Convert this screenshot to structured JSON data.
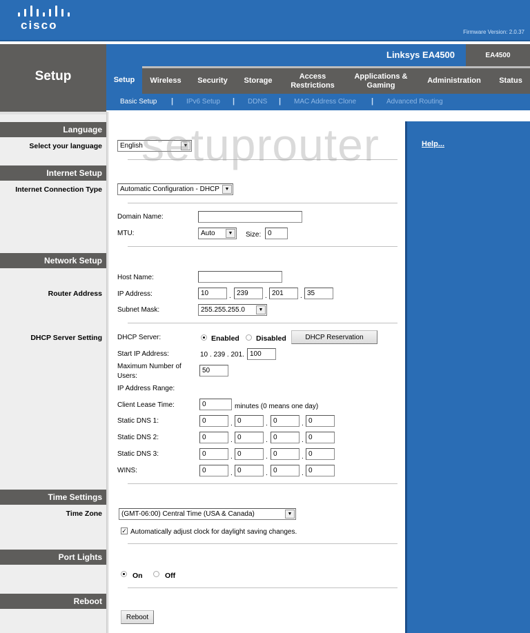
{
  "header": {
    "brand": "cisco",
    "firmware_label": "Firmware Version: 2.0.37",
    "page_title": "Setup",
    "model_name": "Linksys EA4500",
    "model_short": "EA4500"
  },
  "tabs": [
    {
      "label": "Setup",
      "active": true
    },
    {
      "label": "Wireless"
    },
    {
      "label": "Security"
    },
    {
      "label": "Storage"
    },
    {
      "label": "Access Restrictions"
    },
    {
      "label": "Applications & Gaming"
    },
    {
      "label": "Administration"
    },
    {
      "label": "Status"
    }
  ],
  "subnav": [
    {
      "label": "Basic Setup",
      "active": true
    },
    {
      "label": "IPv6 Setup"
    },
    {
      "label": "DDNS"
    },
    {
      "label": "MAC Address Clone"
    },
    {
      "label": "Advanced Routing"
    }
  ],
  "subnav_separator": "|",
  "watermark": "setuprouter",
  "help": {
    "link": "Help..."
  },
  "sections": {
    "language": {
      "heading": "Language",
      "row_label": "Select your language",
      "value": "English"
    },
    "internet": {
      "heading": "Internet Setup",
      "row_label": "Internet Connection Type",
      "connection_type": "Automatic Configuration - DHCP",
      "domain_name_label": "Domain Name:",
      "domain_name_value": "",
      "mtu_label": "MTU:",
      "mtu_value": "Auto",
      "size_label": "Size:",
      "size_value": "0"
    },
    "network": {
      "heading": "Network Setup",
      "router_address_label": "Router Address",
      "host_name_label": "Host Name:",
      "host_name_value": "",
      "ip_label": "IP Address:",
      "ip": [
        "10",
        "239",
        "201",
        "35"
      ],
      "subnet_label": "Subnet Mask:",
      "subnet_value": "255.255.255.0",
      "dhcp_setting_label": "DHCP Server Setting",
      "dhcp_server_label": "DHCP Server:",
      "enabled_label": "Enabled",
      "disabled_label": "Disabled",
      "dhcp_enabled": true,
      "dhcp_reservation_button": "DHCP Reservation",
      "start_ip_label": "Start IP  Address:",
      "start_ip_prefix": "10 . 239 . 201.",
      "start_ip_last": "100",
      "max_users_label_1": "Maximum Number of",
      "max_users_label_2": "Users:",
      "max_users_value": "50",
      "ip_range_label": "IP Address Range:",
      "lease_label": "Client Lease Time:",
      "lease_value": "0",
      "lease_hint": "minutes (0 means one day)",
      "dns": [
        {
          "label": "Static DNS 1:",
          "octets": [
            "0",
            "0",
            "0",
            "0"
          ]
        },
        {
          "label": "Static DNS 2:",
          "octets": [
            "0",
            "0",
            "0",
            "0"
          ]
        },
        {
          "label": "Static DNS 3:",
          "octets": [
            "0",
            "0",
            "0",
            "0"
          ]
        },
        {
          "label": "WINS:",
          "octets": [
            "0",
            "0",
            "0",
            "0"
          ]
        }
      ],
      "octet_separator": "."
    },
    "time": {
      "heading": "Time Settings",
      "row_label": "Time Zone",
      "zone_value": "(GMT-06:00) Central Time (USA & Canada)",
      "dst_label": "Automatically adjust clock for daylight saving changes.",
      "dst_checked": true
    },
    "port_lights": {
      "heading": "Port Lights",
      "on_label": "On",
      "off_label": "Off",
      "on_selected": true
    },
    "reboot": {
      "heading": "Reboot",
      "button": "Reboot"
    }
  }
}
